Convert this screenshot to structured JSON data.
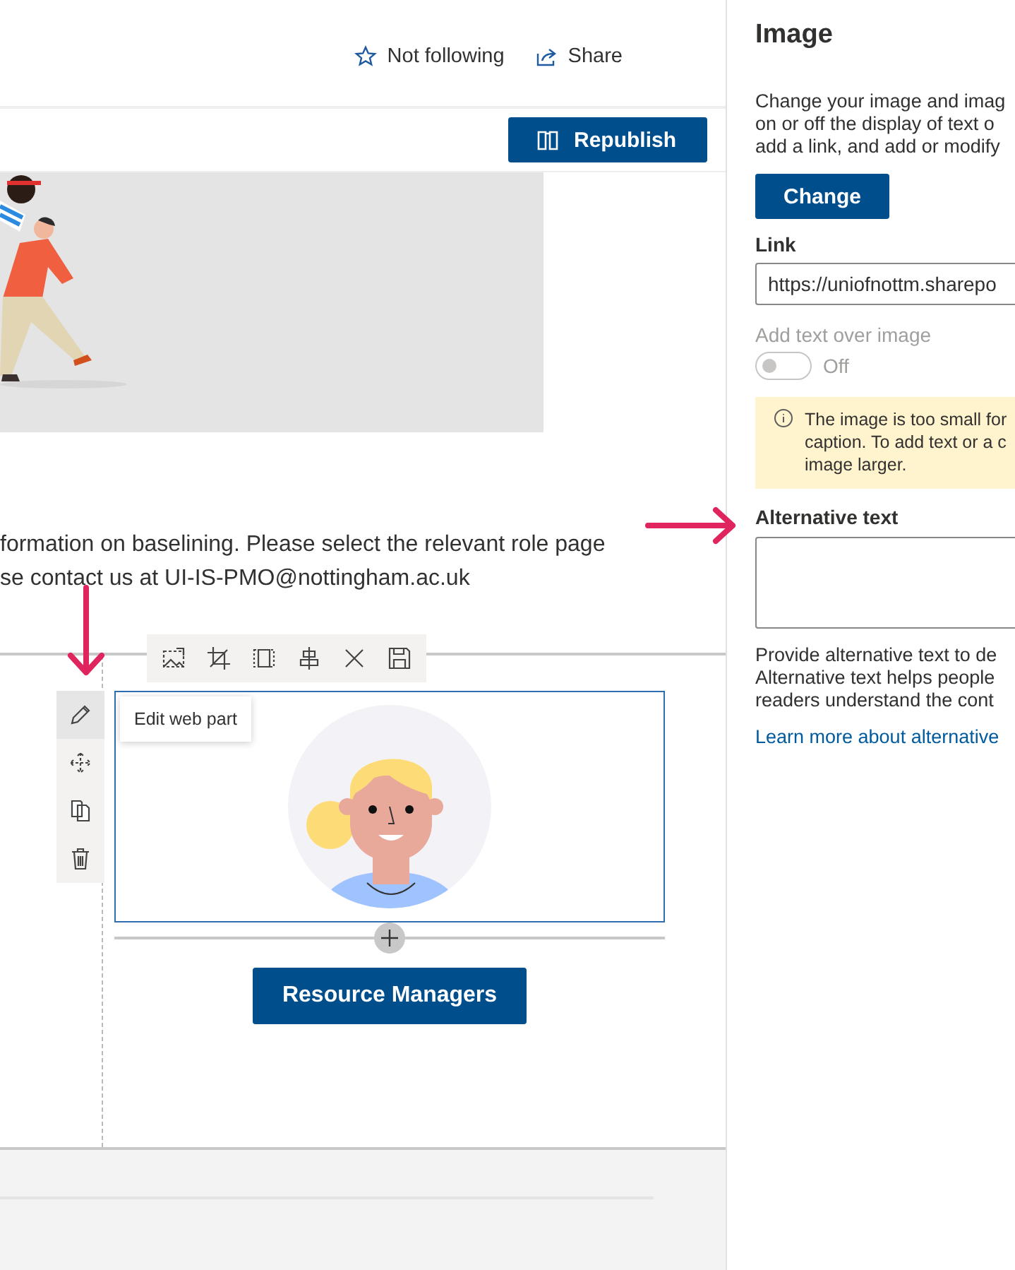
{
  "header": {
    "actions": [
      {
        "kind": "follow",
        "label": "Not following"
      },
      {
        "kind": "share",
        "label": "Share"
      }
    ]
  },
  "command_bar": {
    "publish_button": "Republish"
  },
  "content": {
    "text_lines": [
      "formation on baselining. Please select the relevant role page",
      "se contact us at UI-IS-PMO@nottingham.ac.uk"
    ]
  },
  "web_part_tools": [
    {
      "kind": "edit",
      "selected": true
    },
    {
      "kind": "move",
      "selected": false
    },
    {
      "kind": "duplicate",
      "selected": false
    },
    {
      "kind": "delete",
      "selected": false
    }
  ],
  "tooltip": "Edit web part",
  "role_button": "Resource Managers",
  "panel": {
    "title": "Image",
    "description_lines": [
      "Change your image and imag",
      "on or off the display of text o",
      "add a link, and add or modify"
    ],
    "change_button": "Change",
    "link_label": "Link",
    "link_value": "https://uniofnottm.sharepo",
    "overlay_label": "Add text over image",
    "overlay_toggle": {
      "on": false,
      "disabled": true,
      "label": "Off"
    },
    "notice_lines": [
      "The image is too small for",
      "caption. To add text or a c",
      "image larger."
    ],
    "alt_text_label": "Alternative text",
    "help_lines": [
      "Provide alternative text to de",
      "Alternative text helps people",
      "readers understand the cont"
    ],
    "learn_more_link": "Learn more about alternative"
  }
}
